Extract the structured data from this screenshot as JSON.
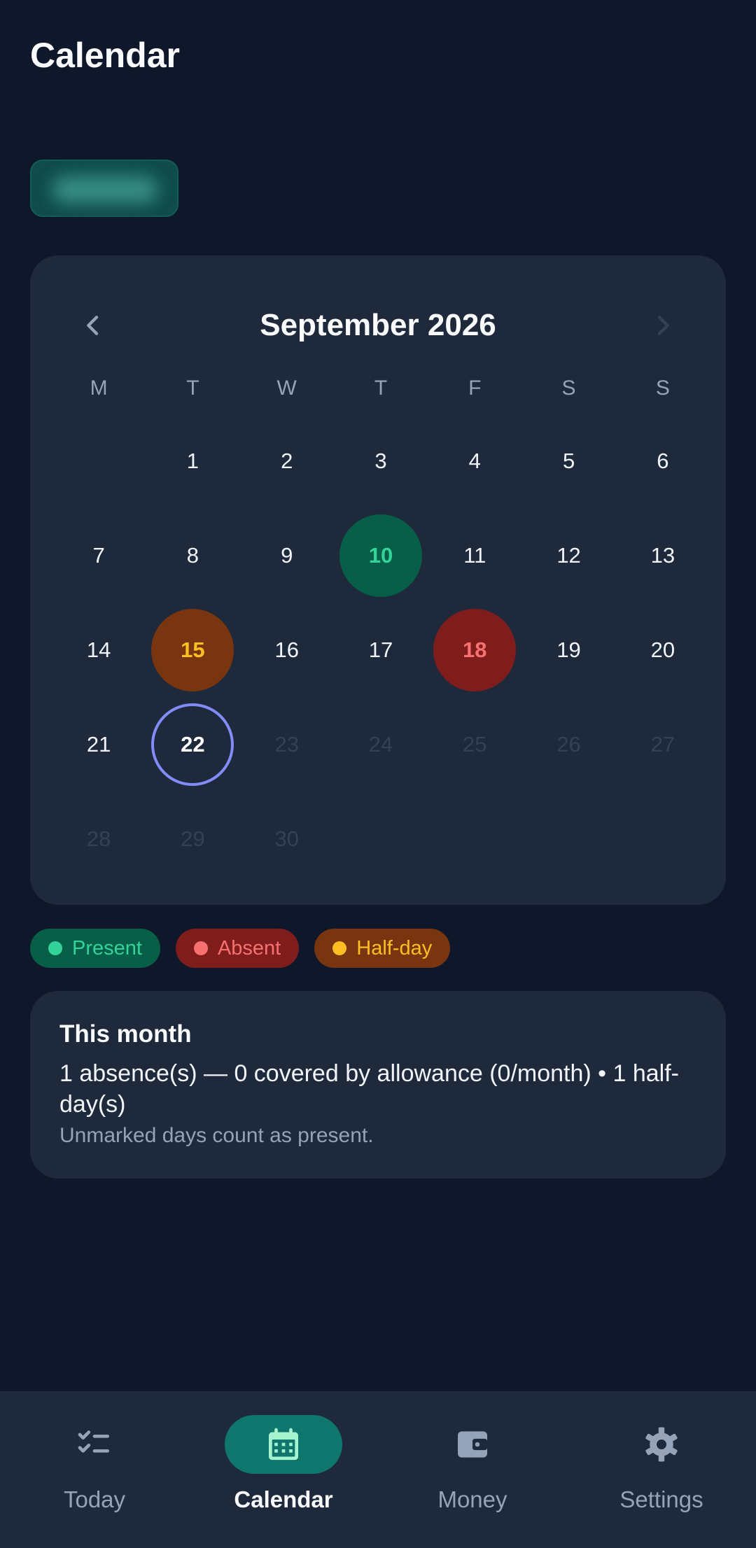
{
  "header": {
    "title": "Calendar"
  },
  "calendar": {
    "month_label": "September 2026",
    "weekdays": [
      "M",
      "T",
      "W",
      "T",
      "F",
      "S",
      "S"
    ],
    "leading_blanks": 1,
    "days": [
      {
        "n": "1",
        "state": "normal"
      },
      {
        "n": "2",
        "state": "normal"
      },
      {
        "n": "3",
        "state": "normal"
      },
      {
        "n": "4",
        "state": "normal"
      },
      {
        "n": "5",
        "state": "normal"
      },
      {
        "n": "6",
        "state": "normal"
      },
      {
        "n": "7",
        "state": "normal"
      },
      {
        "n": "8",
        "state": "normal"
      },
      {
        "n": "9",
        "state": "normal"
      },
      {
        "n": "10",
        "state": "present"
      },
      {
        "n": "11",
        "state": "normal"
      },
      {
        "n": "12",
        "state": "normal"
      },
      {
        "n": "13",
        "state": "normal"
      },
      {
        "n": "14",
        "state": "normal"
      },
      {
        "n": "15",
        "state": "half"
      },
      {
        "n": "16",
        "state": "normal"
      },
      {
        "n": "17",
        "state": "normal"
      },
      {
        "n": "18",
        "state": "absent"
      },
      {
        "n": "19",
        "state": "normal"
      },
      {
        "n": "20",
        "state": "normal"
      },
      {
        "n": "21",
        "state": "normal"
      },
      {
        "n": "22",
        "state": "today"
      },
      {
        "n": "23",
        "state": "future"
      },
      {
        "n": "24",
        "state": "future"
      },
      {
        "n": "25",
        "state": "future"
      },
      {
        "n": "26",
        "state": "future"
      },
      {
        "n": "27",
        "state": "future"
      },
      {
        "n": "28",
        "state": "future"
      },
      {
        "n": "29",
        "state": "future"
      },
      {
        "n": "30",
        "state": "future"
      }
    ]
  },
  "legend": {
    "present": "Present",
    "absent": "Absent",
    "half_day": "Half-day"
  },
  "summary": {
    "title": "This month",
    "line": "1 absence(s) — 0 covered by allowance (0/month) • 1 half-day(s)",
    "note": "Unmarked days count as present."
  },
  "nav": {
    "today": "Today",
    "calendar": "Calendar",
    "money": "Money",
    "settings": "Settings"
  },
  "colors": {
    "background": "#0f172a",
    "card": "#1e293b",
    "present": "#34d399",
    "absent": "#f87171",
    "half_day": "#fbbf24",
    "today_ring": "#818cf8",
    "nav_active": "#0f766e"
  },
  "icons": {
    "prev": "chevron-left-icon",
    "next": "chevron-right-icon",
    "today": "checklist-icon",
    "calendar": "calendar-icon",
    "money": "wallet-icon",
    "settings": "gear-icon"
  }
}
